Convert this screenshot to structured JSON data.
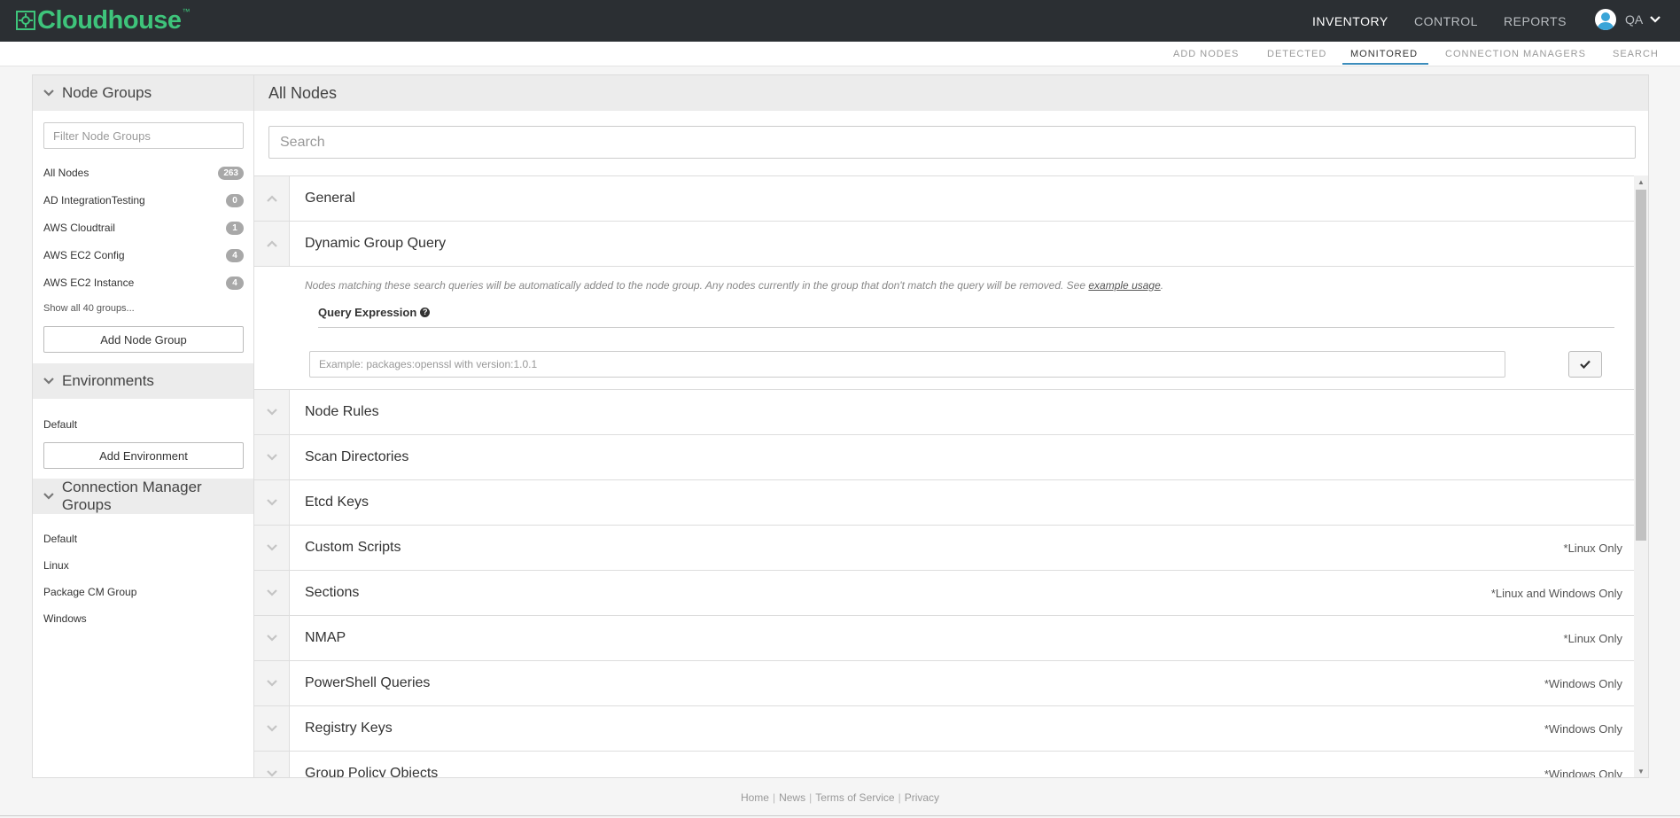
{
  "brand": {
    "name": "Cloudhouse",
    "tm": "™",
    "color": "#3ec47b"
  },
  "topnav": {
    "inventory": "INVENTORY",
    "control": "CONTROL",
    "reports": "REPORTS",
    "user": "QA"
  },
  "subnav": {
    "add_nodes": "ADD NODES",
    "detected": "DETECTED",
    "monitored": "MONITORED",
    "connection_managers": "CONNECTION MANAGERS",
    "search": "SEARCH",
    "active": "MONITORED"
  },
  "sidebar": {
    "node_groups": {
      "title": "Node Groups",
      "filter_placeholder": "Filter Node Groups",
      "items": [
        {
          "label": "All Nodes",
          "count": "263"
        },
        {
          "label": "AD IntegrationTesting",
          "count": "0"
        },
        {
          "label": "AWS Cloudtrail",
          "count": "1"
        },
        {
          "label": "AWS EC2 Config",
          "count": "4"
        },
        {
          "label": "AWS EC2 Instance",
          "count": "4"
        }
      ],
      "show_all": "Show all 40 groups...",
      "add_button": "Add Node Group"
    },
    "environments": {
      "title": "Environments",
      "items": [
        "Default"
      ],
      "add_button": "Add Environment"
    },
    "cm_groups": {
      "title": "Connection Manager Groups",
      "items": [
        "Default",
        "Linux",
        "Package CM Group",
        "Windows"
      ]
    }
  },
  "main": {
    "title": "All Nodes",
    "search_placeholder": "Search",
    "sections": {
      "general": "General",
      "dgq": "Dynamic Group Query",
      "dgq_desc": "Nodes matching these search queries will be automatically added to the node group. Any nodes currently in the group that don't match the query will be removed. See ",
      "dgq_link": "example usage",
      "dgq_period": ".",
      "query_label": "Query Expression",
      "query_placeholder": "Example: packages:openssl with version:1.0.1",
      "rows": [
        {
          "title": "Node Rules",
          "note": ""
        },
        {
          "title": "Scan Directories",
          "note": ""
        },
        {
          "title": "Etcd Keys",
          "note": ""
        },
        {
          "title": "Custom Scripts",
          "note": "*Linux Only"
        },
        {
          "title": "Sections",
          "note": "*Linux and Windows Only"
        },
        {
          "title": "NMAP",
          "note": "*Linux Only"
        },
        {
          "title": "PowerShell Queries",
          "note": "*Windows Only"
        },
        {
          "title": "Registry Keys",
          "note": "*Windows Only"
        },
        {
          "title": "Group Policy Objects",
          "note": "*Windows Only"
        }
      ]
    }
  },
  "footer": {
    "home": "Home",
    "news": "News",
    "tos": "Terms of Service",
    "privacy": "Privacy",
    "sep": "|"
  }
}
